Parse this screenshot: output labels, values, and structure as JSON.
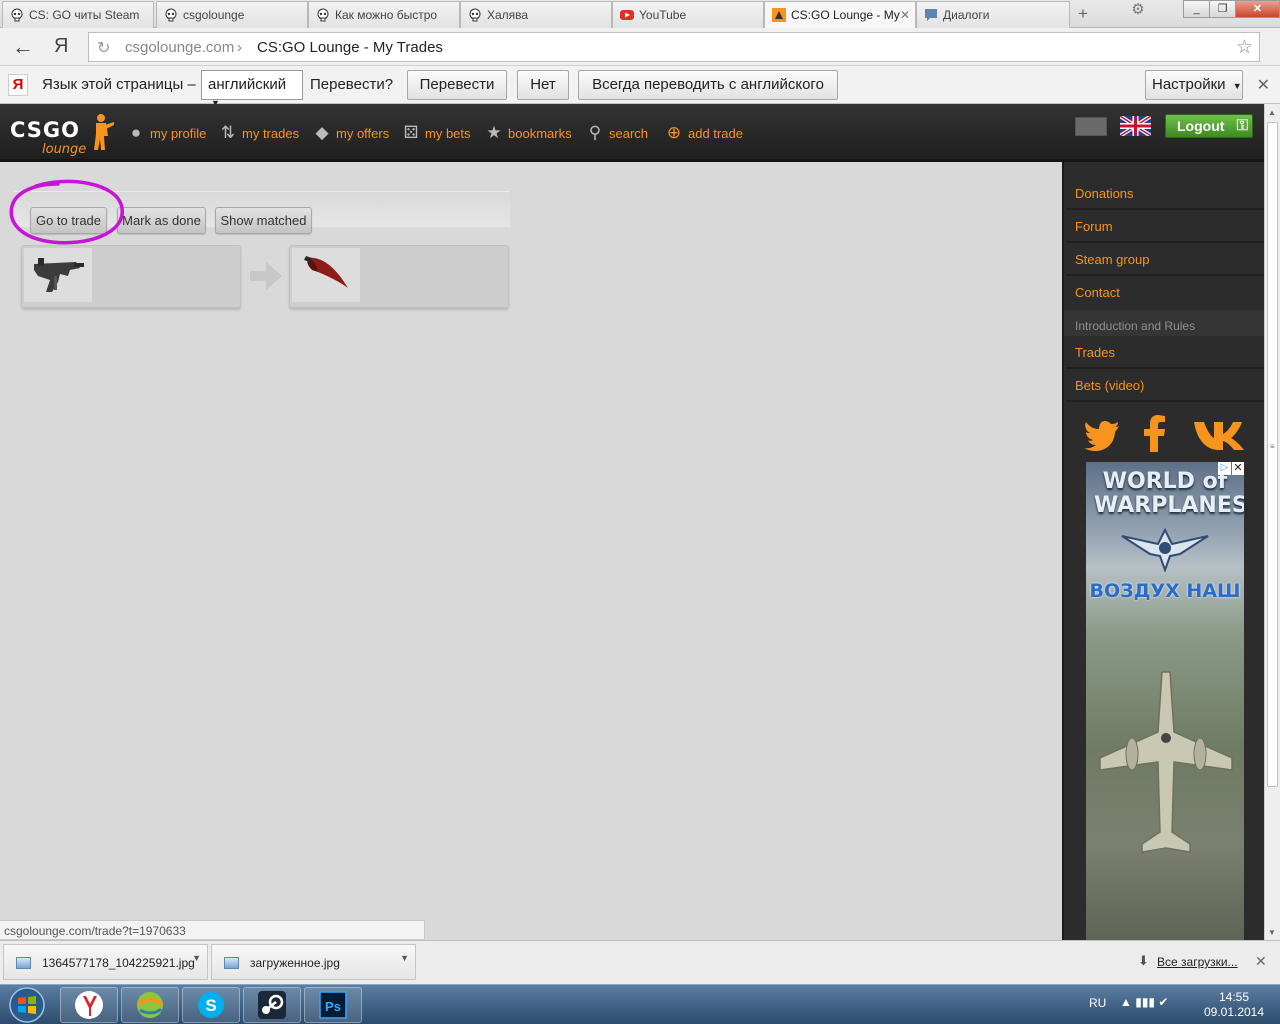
{
  "browser": {
    "tabs": [
      {
        "title": "CS: GO читы Steam",
        "icon": "skull-icon"
      },
      {
        "title": "csgolounge",
        "icon": "skull-icon"
      },
      {
        "title": "Как можно быстро",
        "icon": "skull-icon"
      },
      {
        "title": "Халява",
        "icon": "skull-icon"
      },
      {
        "title": "YouTube",
        "icon": "youtube-icon"
      },
      {
        "title": "CS:GO Lounge - My",
        "icon": "csgolounge-icon",
        "active": true
      },
      {
        "title": "Диалоги",
        "icon": "chat-icon"
      }
    ],
    "address": {
      "domain": "csgolounge.com",
      "separator": "›",
      "title": "CS:GO Lounge - My Trades"
    }
  },
  "translate_bar": {
    "logo": "Я",
    "prompt": "Язык этой страницы –",
    "language": "английский",
    "question": "Перевести?",
    "translate_button": "Перевести",
    "no_button": "Нет",
    "always_button": "Всегда переводить с английского",
    "settings_button": "Настройки"
  },
  "site": {
    "logo_main": "CSGO",
    "logo_sub": "lounge",
    "nav": [
      {
        "label": "my profile",
        "icon": "user-icon"
      },
      {
        "label": "my trades",
        "icon": "trade-arrows-icon"
      },
      {
        "label": "my offers",
        "icon": "tag-icon"
      },
      {
        "label": "my bets",
        "icon": "dice-icon"
      },
      {
        "label": "bookmarks",
        "icon": "star-icon"
      },
      {
        "label": "search",
        "icon": "magnifier-icon"
      },
      {
        "label": "add trade",
        "icon": "plus-circle-icon"
      }
    ],
    "logout": "Logout"
  },
  "trade": {
    "go_to_trade": "Go to trade",
    "mark_as_done": "Mark as done",
    "show_matched": "Show matched",
    "offer_item": "smg-weapon-icon",
    "want_item": "knife-icon"
  },
  "sidebar": {
    "links": [
      "Donations",
      "Forum",
      "Steam group",
      "Contact"
    ],
    "section_heading": "Introduction and Rules",
    "section_links": [
      "Trades",
      "Bets (video)"
    ],
    "social": [
      "twitter-icon",
      "facebook-icon",
      "vk-icon"
    ],
    "ad": {
      "title_line1": "WORLD of",
      "title_line2": "WARPLANES",
      "tagline": "ВОЗДУХ НАШ"
    }
  },
  "status_url": "csgolounge.com/trade?t=1970633",
  "downloads": {
    "items": [
      "1364577178_104225921.jpg",
      "загруженное.jpg"
    ],
    "show_all": "Все загрузки..."
  },
  "taskbar": {
    "language": "RU",
    "time": "14:55",
    "date": "09.01.2014",
    "apps": [
      "yandex-browser-icon",
      "app-icon",
      "skype-icon",
      "steam-icon",
      "photoshop-icon"
    ]
  },
  "colors": {
    "accent": "#f7941d",
    "header_bg": "#262626",
    "logout_green": "#4fa02d",
    "annotation": "#c814d8"
  }
}
